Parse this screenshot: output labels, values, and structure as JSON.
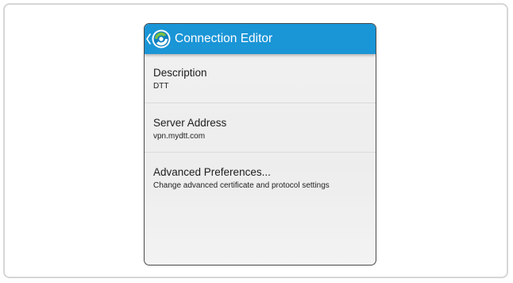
{
  "action_bar": {
    "title": "Connection Editor",
    "background": "#1a95d6",
    "icon": "app-logo-icon"
  },
  "preferences": [
    {
      "title": "Description",
      "summary": "DTT"
    },
    {
      "title": "Server Address",
      "summary": "vpn.mydtt.com"
    },
    {
      "title": "Advanced Preferences...",
      "summary": "Change advanced certificate and protocol settings"
    }
  ]
}
